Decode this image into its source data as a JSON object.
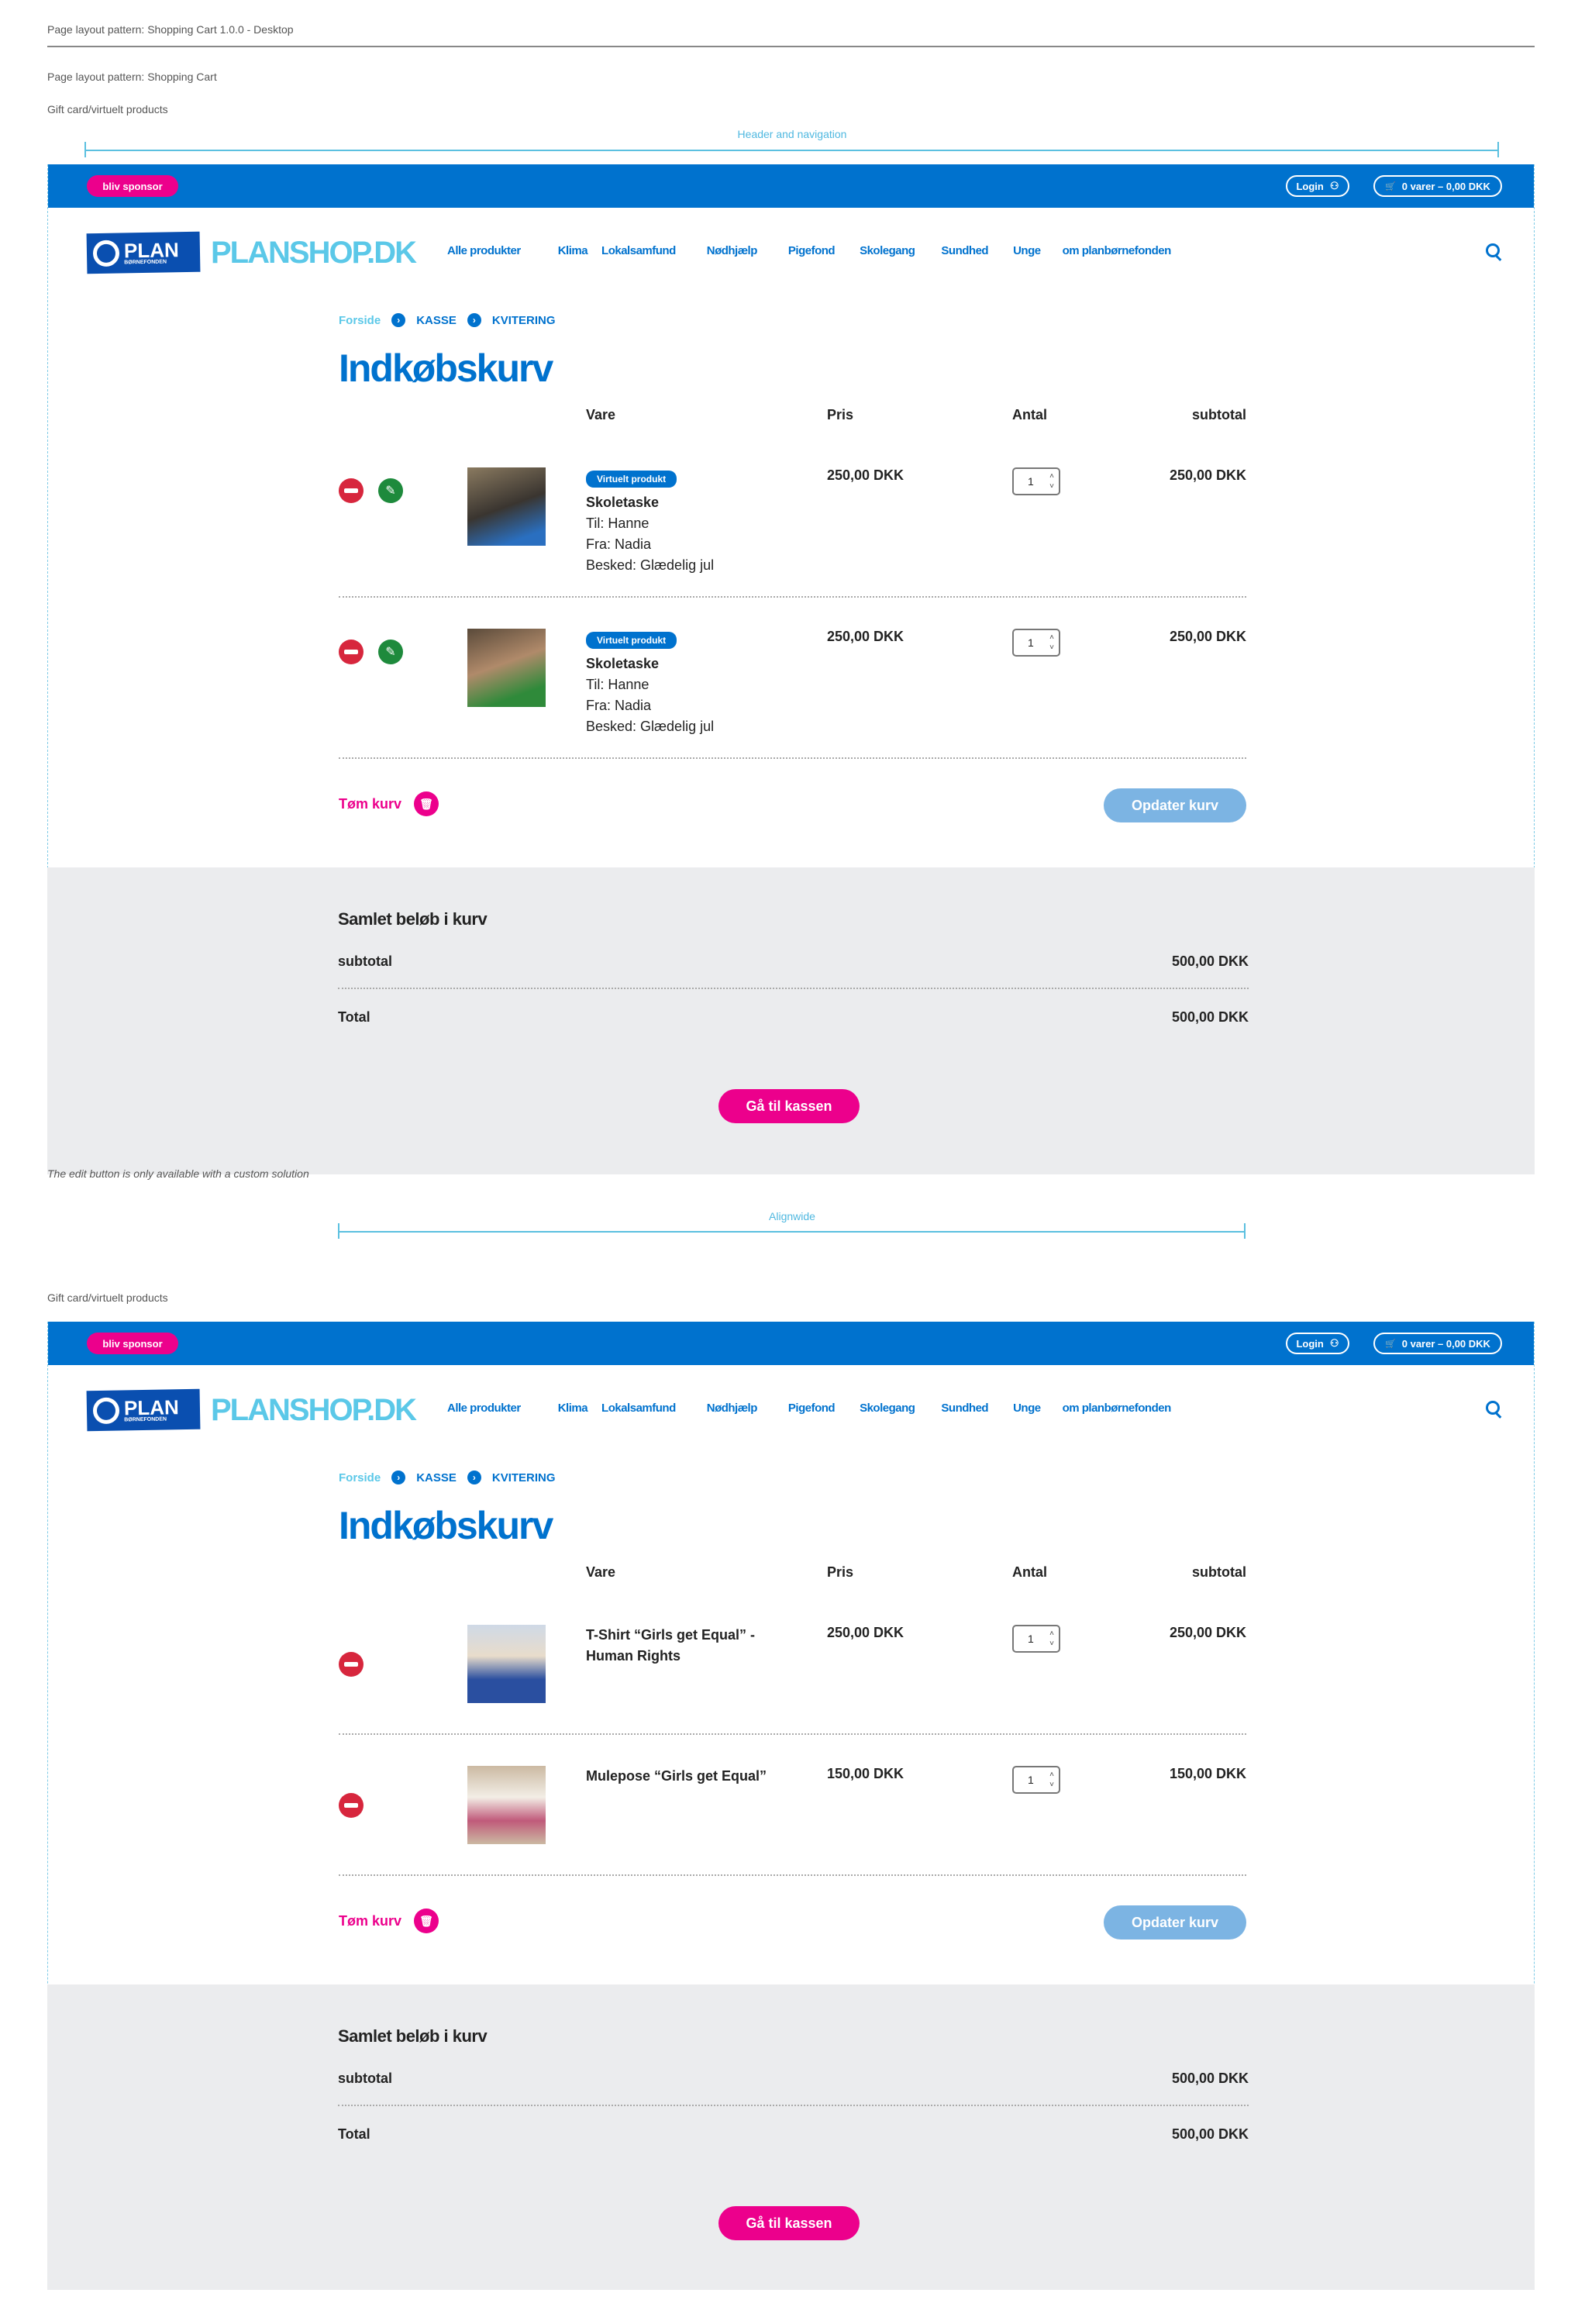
{
  "annotations": {
    "page_title": "Page layout pattern: Shopping Cart 1.0.0 - Desktop",
    "subtitle": "Page layout pattern: Shopping Cart",
    "section1_label": "Gift card/virtuelt products",
    "header_measure": "Header and navigation",
    "edit_note": "The edit button is only available with a custom solution",
    "alignwide_measure": "Alignwide",
    "section2_label": "Gift card/virtuelt products"
  },
  "colors": {
    "brand_blue": "#0072ce",
    "accent_pink": "#ec008c",
    "logo_light_blue": "#5bc8e8",
    "remove_red": "#d7263d",
    "edit_green": "#1e8a3c",
    "update_button": "#7cb4e3",
    "summary_bg": "#ebecee"
  },
  "header": {
    "sponsor": "bliv sponsor",
    "login": "Login",
    "cart": "0 varer – 0,00 DKK",
    "logo_plan": "PLAN",
    "logo_sub": "BØRNEFONDEN",
    "shop_name": "PLANSHOP.DK",
    "nav": [
      "Alle produkter",
      "Klima",
      "Lokalsamfund",
      "Nødhjælp",
      "Pigefond",
      "Skolegang",
      "Sundhed",
      "Unge",
      "om planbørnefonden"
    ]
  },
  "breadcrumb": [
    "Forside",
    "KASSE",
    "KVITERING"
  ],
  "page_heading": "Indkøbskurv",
  "columns": {
    "item": "Vare",
    "price": "Pris",
    "qty": "Antal",
    "subtotal": "subtotal"
  },
  "actions": {
    "empty_cart": "Tøm kurv",
    "update_cart": "Opdater kurv"
  },
  "summary_labels": {
    "title": "Samlet beløb i kurv",
    "subtotal": "subtotal",
    "total": "Total",
    "checkout": "Gå til kassen"
  },
  "carts": [
    {
      "items": [
        {
          "badge": "Virtuelt produkt",
          "name": "Skoletaske",
          "details": [
            "Til: Hanne",
            "Fra: Nadia",
            "Besked: Glædelig jul"
          ],
          "price": "250,00 DKK",
          "qty": "1",
          "subtotal": "250,00 DKK",
          "editable": true
        },
        {
          "badge": "Virtuelt produkt",
          "name": "Skoletaske",
          "details": [
            "Til: Hanne",
            "Fra: Nadia",
            "Besked: Glædelig jul"
          ],
          "price": "250,00 DKK",
          "qty": "1",
          "subtotal": "250,00 DKK",
          "editable": true
        }
      ],
      "summary": {
        "subtotal": "500,00 DKK",
        "total": "500,00 DKK"
      }
    },
    {
      "items": [
        {
          "name": "T-Shirt “Girls get Equal” - Human Rights",
          "details": [],
          "price": "250,00 DKK",
          "qty": "1",
          "subtotal": "250,00 DKK",
          "editable": false
        },
        {
          "name": "Mulepose “Girls get Equal”",
          "details": [],
          "price": "150,00 DKK",
          "qty": "1",
          "subtotal": "150,00 DKK",
          "editable": false
        }
      ],
      "summary": {
        "subtotal": "500,00 DKK",
        "total": "500,00 DKK"
      }
    }
  ]
}
